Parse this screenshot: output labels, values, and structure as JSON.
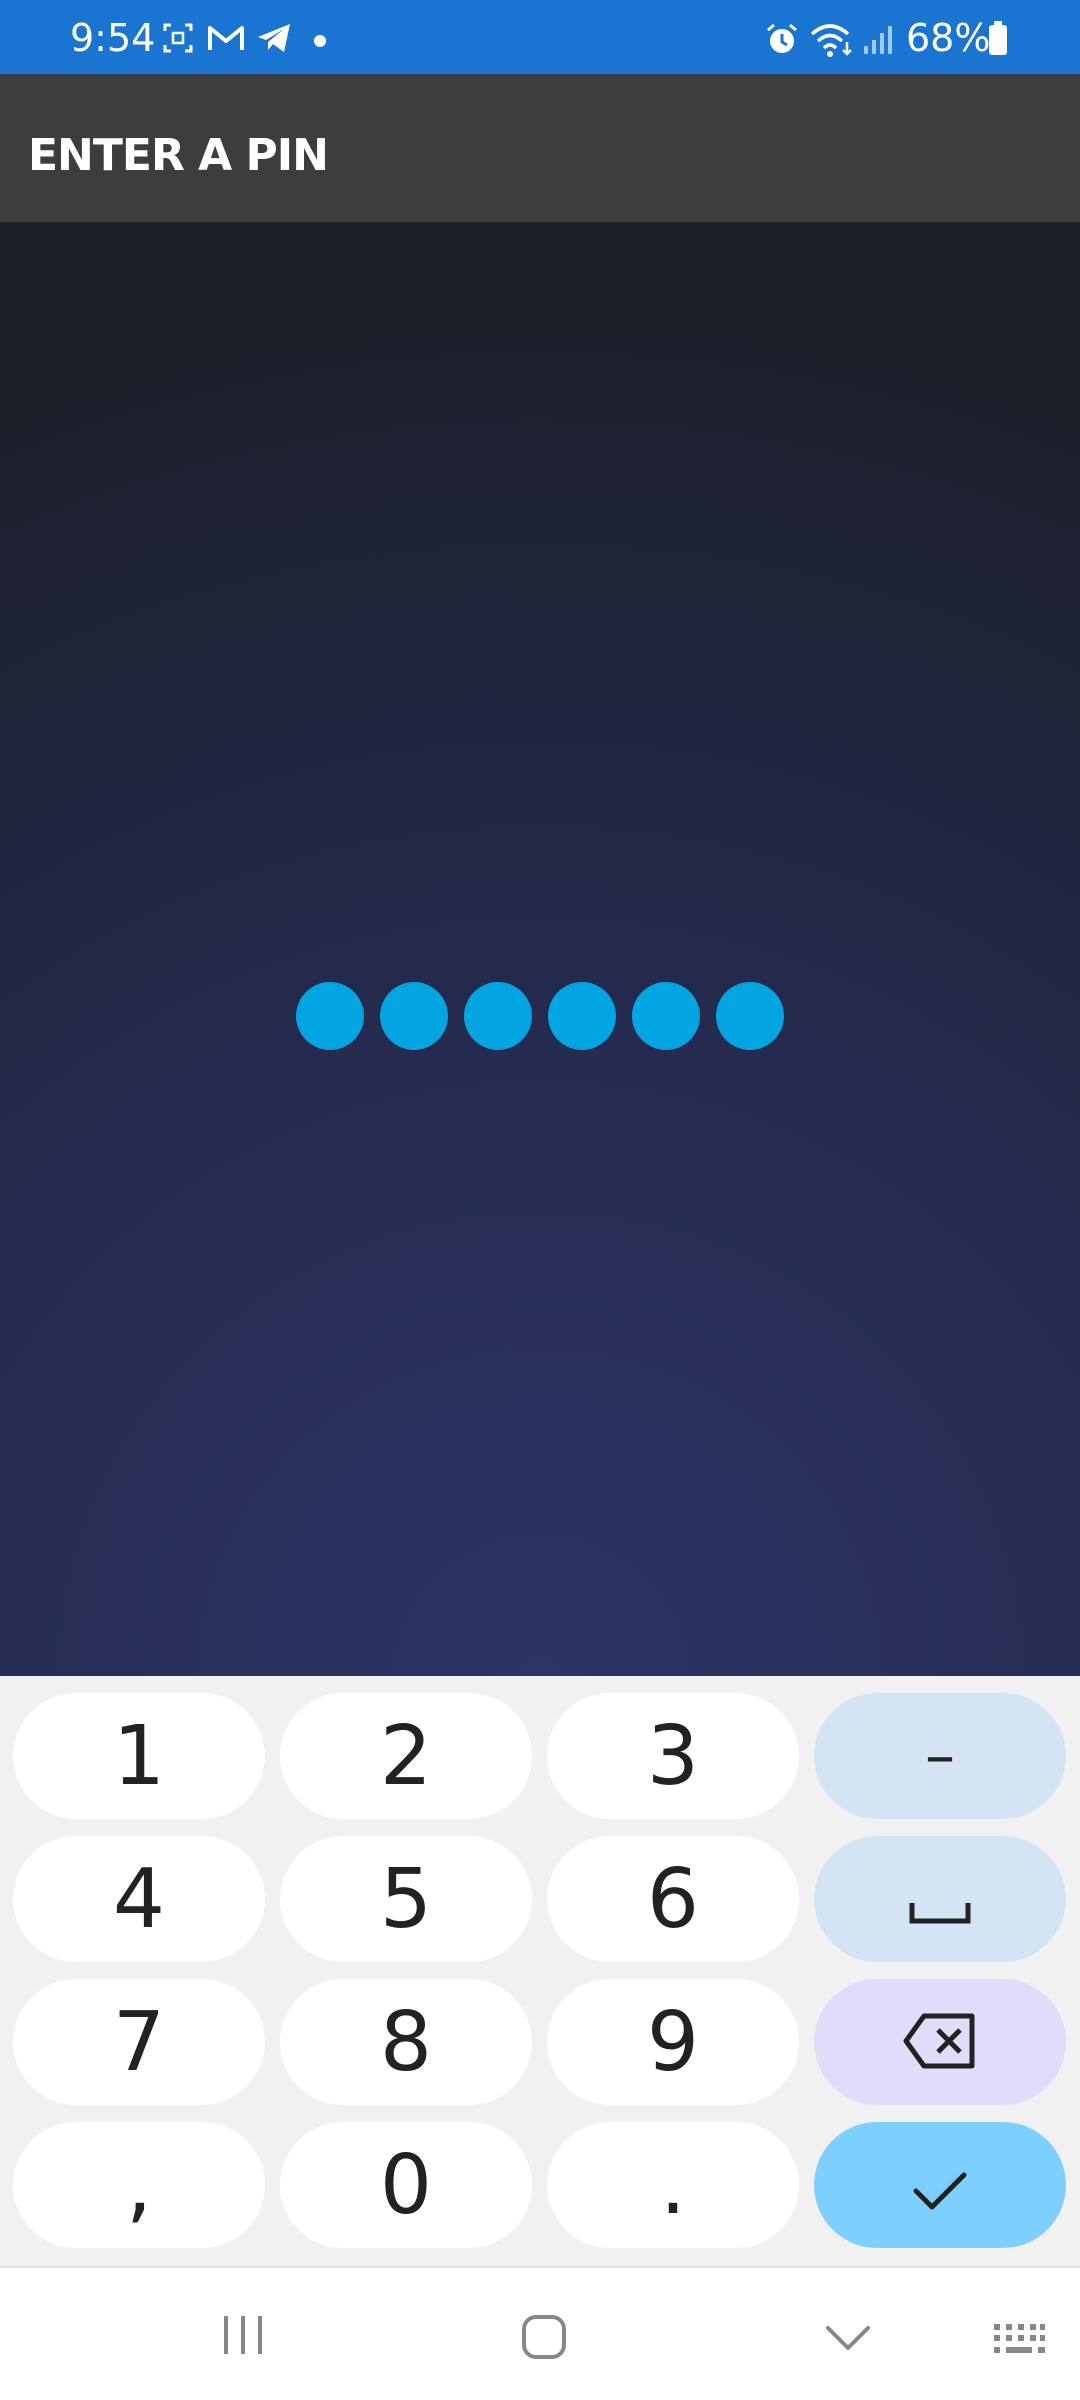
{
  "status_bar": {
    "time": "9:54",
    "battery_percent": "68%",
    "icons": [
      "screenshot-icon",
      "gmail-icon",
      "telegram-icon",
      "notification-dot-icon",
      "alarm-icon",
      "wifi-icon",
      "signal-icon",
      "battery-icon"
    ],
    "background": "#1a75d2"
  },
  "app_bar": {
    "title": "ENTER A PIN",
    "background": "#3d3d40"
  },
  "pin": {
    "entered_digits": 6,
    "dot_color": "#03a4e2"
  },
  "keyboard": {
    "rows": [
      [
        "1",
        "2",
        "3",
        "–"
      ],
      [
        "4",
        "5",
        "6",
        "space"
      ],
      [
        "7",
        "8",
        "9",
        "backspace"
      ],
      [
        ",",
        "0",
        ".",
        "done"
      ]
    ],
    "keys": {
      "k1": "1",
      "k2": "2",
      "k3": "3",
      "dash": "–",
      "k4": "4",
      "k5": "5",
      "k6": "6",
      "k7": "7",
      "k8": "8",
      "k9": "9",
      "comma": ",",
      "k0": "0",
      "period": "."
    },
    "colors": {
      "background": "#f1f1f1",
      "key": "#ffffff",
      "fn_key": "#d3e5f4",
      "backspace_key": "#e1dcfa",
      "enter_key": "#7dcffd"
    }
  },
  "nav_bar": {
    "buttons": [
      "recents-icon",
      "home-icon",
      "hide-keyboard-icon",
      "keyboard-switch-icon"
    ]
  }
}
